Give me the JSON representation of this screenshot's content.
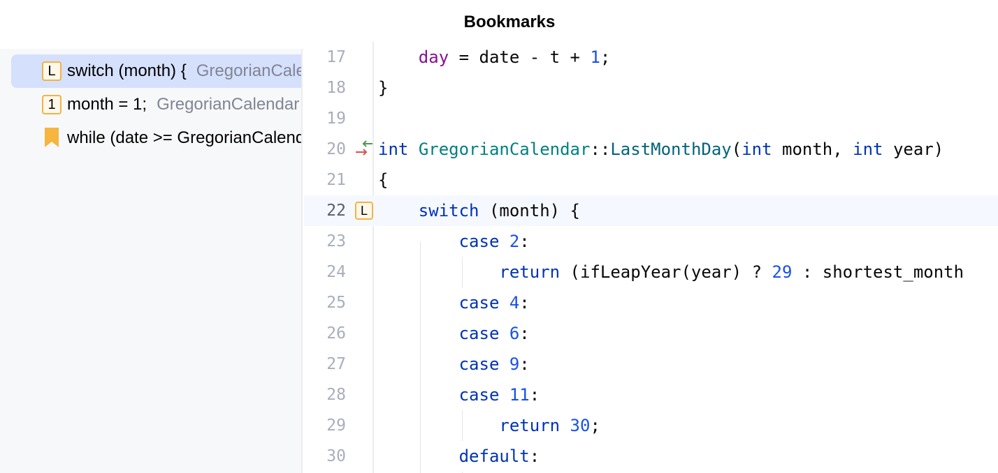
{
  "window": {
    "title": "Bookmarks"
  },
  "sidebar": {
    "items": [
      {
        "type": "mnemonic",
        "mnemonic": "L",
        "icon": "mnemonic-bookmark-icon",
        "text": "switch (month) {",
        "location": "GregorianCalendar",
        "selected": true
      },
      {
        "type": "mnemonic",
        "mnemonic": "1",
        "icon": "mnemonic-bookmark-icon",
        "text": "month = 1;",
        "location": "GregorianCalendar",
        "selected": false
      },
      {
        "type": "plain",
        "icon": "bookmark-icon",
        "text": "while (date >= GregorianCalendar",
        "location": "",
        "selected": false
      }
    ]
  },
  "editor": {
    "current_line": 22,
    "lines": [
      {
        "n": "17",
        "tokens": [
          [
            "    ",
            ""
          ],
          [
            "day",
            "var"
          ],
          [
            " = date - t + ",
            ""
          ],
          [
            "1",
            "num"
          ],
          [
            ";",
            ""
          ]
        ]
      },
      {
        "n": "18",
        "tokens": [
          [
            "}",
            ""
          ]
        ]
      },
      {
        "n": "19",
        "tokens": []
      },
      {
        "n": "20",
        "gutter": "implement-arrows",
        "tokens": [
          [
            "int",
            "kw"
          ],
          [
            " ",
            ""
          ],
          [
            "GregorianCalendar",
            "cls"
          ],
          [
            "::",
            ""
          ],
          [
            "LastMonthDay",
            "fn"
          ],
          [
            "(",
            ""
          ],
          [
            "int",
            "kw"
          ],
          [
            " month, ",
            ""
          ],
          [
            "int",
            "kw"
          ],
          [
            " year)",
            ""
          ]
        ]
      },
      {
        "n": "21",
        "tokens": [
          [
            "{",
            ""
          ]
        ]
      },
      {
        "n": "22",
        "gutter": "mnemonic",
        "mnemonic": "L",
        "tokens": [
          [
            "    ",
            ""
          ],
          [
            "switch",
            "kw"
          ],
          [
            " (month) {",
            ""
          ]
        ]
      },
      {
        "n": "23",
        "tokens": [
          [
            "        ",
            ""
          ],
          [
            "case",
            "kw"
          ],
          [
            " ",
            ""
          ],
          [
            "2",
            "num"
          ],
          [
            ":",
            ""
          ]
        ]
      },
      {
        "n": "24",
        "tokens": [
          [
            "            ",
            ""
          ],
          [
            "return",
            "kw"
          ],
          [
            " (ifLeapYear(year) ? ",
            ""
          ],
          [
            "29",
            "num"
          ],
          [
            " : shortest_month",
            ""
          ]
        ]
      },
      {
        "n": "25",
        "tokens": [
          [
            "        ",
            ""
          ],
          [
            "case",
            "kw"
          ],
          [
            " ",
            ""
          ],
          [
            "4",
            "num"
          ],
          [
            ":",
            ""
          ]
        ]
      },
      {
        "n": "26",
        "tokens": [
          [
            "        ",
            ""
          ],
          [
            "case",
            "kw"
          ],
          [
            " ",
            ""
          ],
          [
            "6",
            "num"
          ],
          [
            ":",
            ""
          ]
        ]
      },
      {
        "n": "27",
        "tokens": [
          [
            "        ",
            ""
          ],
          [
            "case",
            "kw"
          ],
          [
            " ",
            ""
          ],
          [
            "9",
            "num"
          ],
          [
            ":",
            ""
          ]
        ]
      },
      {
        "n": "28",
        "tokens": [
          [
            "        ",
            ""
          ],
          [
            "case",
            "kw"
          ],
          [
            " ",
            ""
          ],
          [
            "11",
            "num"
          ],
          [
            ":",
            ""
          ]
        ]
      },
      {
        "n": "29",
        "tokens": [
          [
            "            ",
            ""
          ],
          [
            "return",
            "kw"
          ],
          [
            " ",
            ""
          ],
          [
            "30",
            "num"
          ],
          [
            ";",
            ""
          ]
        ]
      },
      {
        "n": "30",
        "tokens": [
          [
            "        ",
            ""
          ],
          [
            "default",
            "kw"
          ],
          [
            ":",
            ""
          ]
        ]
      }
    ]
  }
}
